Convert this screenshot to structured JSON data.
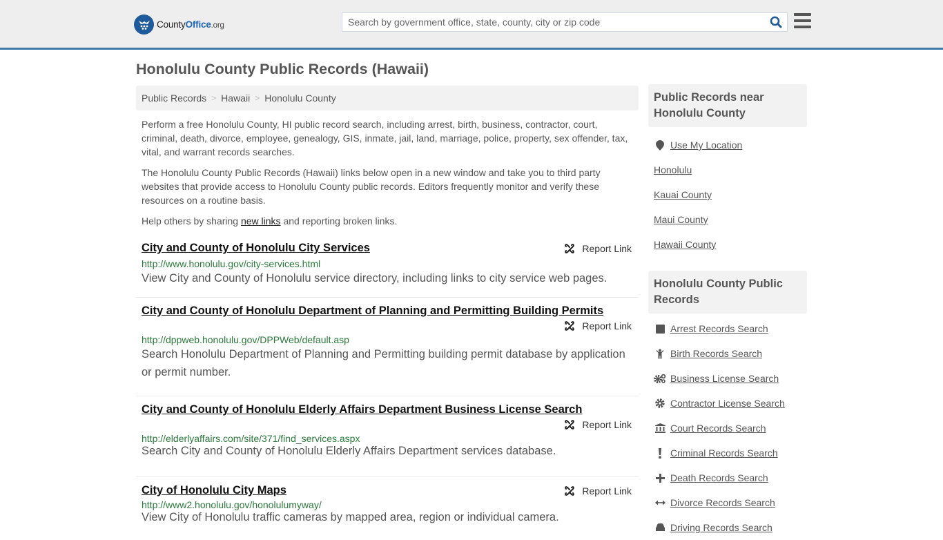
{
  "header": {
    "logo": {
      "brand_part1": "County",
      "brand_part2": "Office",
      "brand_suffix": ".org"
    },
    "search": {
      "placeholder": "Search by government office, state, county, city or zip code",
      "value": ""
    },
    "colors": {
      "accent": "#3e78a7",
      "brand_blue": "#1f5a9a",
      "search_icon": "#1f5a9a"
    }
  },
  "page": {
    "title": "Honolulu County Public Records (Hawaii)"
  },
  "breadcrumb": [
    {
      "label": "Public Records"
    },
    {
      "label": "Hawaii"
    },
    {
      "label": "Honolulu County"
    }
  ],
  "breadcrumb_separator": ">",
  "intro": {
    "p1": "Perform a free Honolulu County, HI public record search, including arrest, birth, business, contractor, court, criminal, death, divorce, employee, genealogy, GIS, inmate, jail, land, marriage, police, property, sex offender, tax, vital, and warrant records searches.",
    "p2": "The Honolulu County Public Records (Hawaii) links below open in a new window and take you to third party websites that provide access to Honolulu County public records. Editors frequently monitor and verify these resources on a routine basis.",
    "p3_before": "Help others by sharing ",
    "p3_link": "new links",
    "p3_after": " and reporting broken links."
  },
  "results": [
    {
      "title": "City and County of Honolulu City Services",
      "report_label": "Report Link",
      "url": "http://www.honolulu.gov/city-services.html",
      "description": "View City and County of Honolulu service directory, including links to city service web pages."
    },
    {
      "title": "City and County of Honolulu Department of Planning and Permitting Building Permits",
      "report_label": "Report Link",
      "url": "http://dppweb.honolulu.gov/DPPWeb/default.asp",
      "description": "Search Honolulu Department of Planning and Permitting building permit database by application or permit number."
    },
    {
      "title": "City and County of Honolulu Elderly Affairs Department Business License Search",
      "report_label": "Report Link",
      "url": "http://elderlyaffairs.com/site/371/find_services.aspx",
      "description": "Search City and County of Honolulu Elderly Affairs Department services database."
    },
    {
      "title": "City of Honolulu City Maps",
      "report_label": "Report Link",
      "url": "http://www2.honolulu.gov/honolulumyway/",
      "description": "View City of Honolulu traffic cameras by mapped area, region or individual camera."
    }
  ],
  "sidebar": {
    "nearby": {
      "heading": "Public Records near Honolulu County",
      "use_location": {
        "label": "Use My Location",
        "icon": "map-marker-icon"
      },
      "items": [
        {
          "label": "Honolulu"
        },
        {
          "label": "Kauai County"
        },
        {
          "label": "Maui County"
        },
        {
          "label": "Hawaii County"
        }
      ]
    },
    "records": {
      "heading": "Honolulu County Public Records",
      "items": [
        {
          "label": "Arrest Records Search",
          "icon": "square-icon"
        },
        {
          "label": "Birth Records Search",
          "icon": "child-icon"
        },
        {
          "label": "Business License Search",
          "icon": "gears-icon"
        },
        {
          "label": "Contractor License Search",
          "icon": "gear-icon"
        },
        {
          "label": "Court Records Search",
          "icon": "courthouse-icon"
        },
        {
          "label": "Criminal Records Search",
          "icon": "exclamation-icon"
        },
        {
          "label": "Death Records Search",
          "icon": "plus-icon"
        },
        {
          "label": "Divorce Records Search",
          "icon": "arrows-horizontal-icon"
        },
        {
          "label": "Driving Records Search",
          "icon": "car-icon"
        }
      ]
    }
  }
}
